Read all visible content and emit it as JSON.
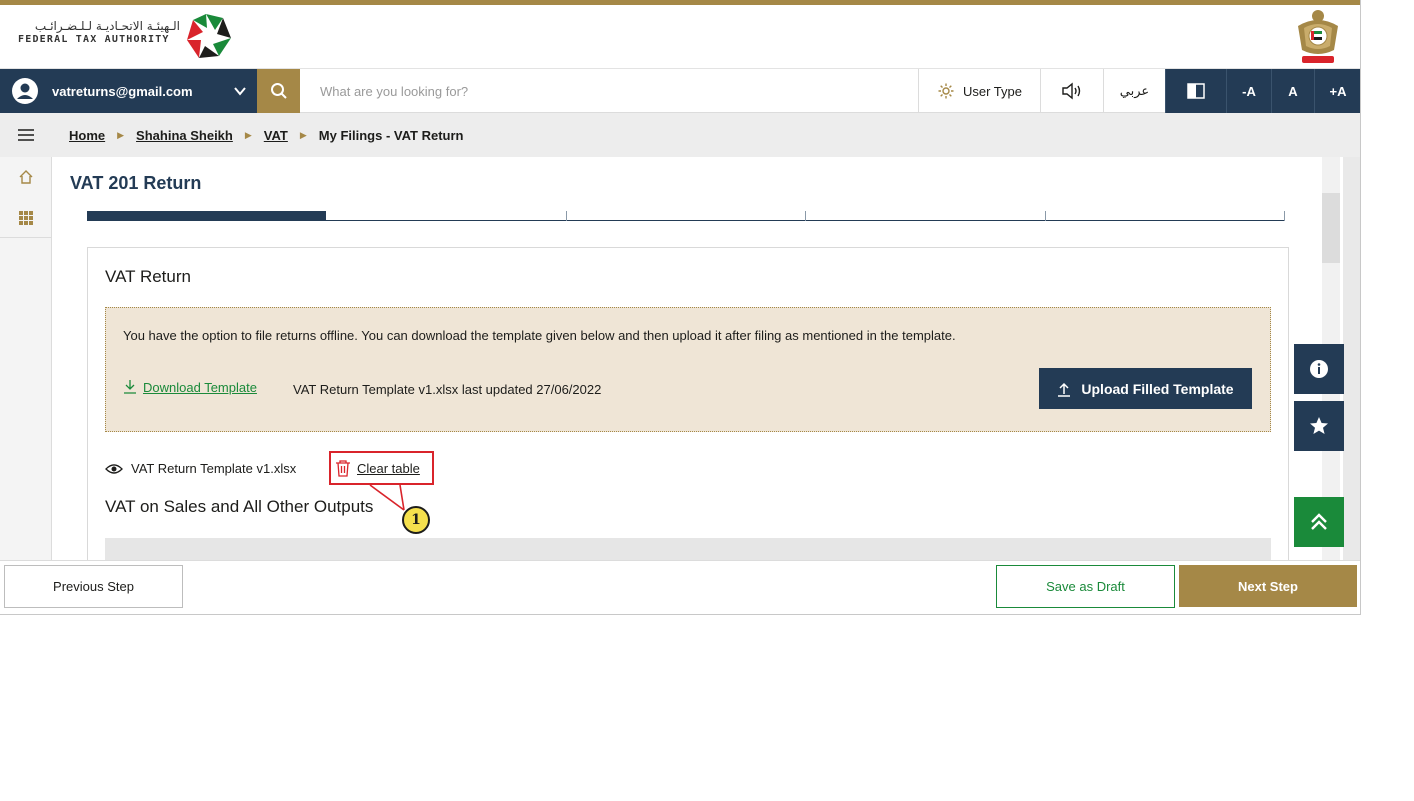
{
  "header": {
    "logo_ar": "الـهيئـة الاتحـاديـة لـلـضـرائـب",
    "logo_en": "FEDERAL TAX AUTHORITY"
  },
  "nav": {
    "user_email": "vatreturns@gmail.com",
    "search_placeholder": "What are you looking for?",
    "user_type": "User Type",
    "language": "عربي",
    "font_decrease": "-A",
    "font_reset": "A",
    "font_increase": "+A"
  },
  "breadcrumb": {
    "items": [
      "Home",
      "Shahina Sheikh",
      "VAT"
    ],
    "current": "My Filings - VAT Return"
  },
  "page": {
    "title": "VAT 201 Return",
    "steps_completed": 1,
    "steps_total": 5
  },
  "vat_return": {
    "title": "VAT Return",
    "notice": "You have the option to file returns offline. You can download the template given below and then upload it after filing as mentioned in the template.",
    "download_label": "Download Template",
    "template_meta": "VAT Return Template v1.xlsx last updated 27/06/2022",
    "upload_label": "Upload Filled Template",
    "uploaded_file": "VAT Return Template v1.xlsx",
    "clear_label": "Clear table",
    "section_title": "VAT on Sales and All Other Outputs",
    "callout_number": "1"
  },
  "footer": {
    "previous": "Previous Step",
    "save_draft": "Save as Draft",
    "next": "Next Step"
  },
  "colors": {
    "navy": "#233b55",
    "gold": "#a58847",
    "green": "#1a8a3a",
    "notice_bg": "#efe5d6",
    "highlight_red": "#d9242b"
  }
}
